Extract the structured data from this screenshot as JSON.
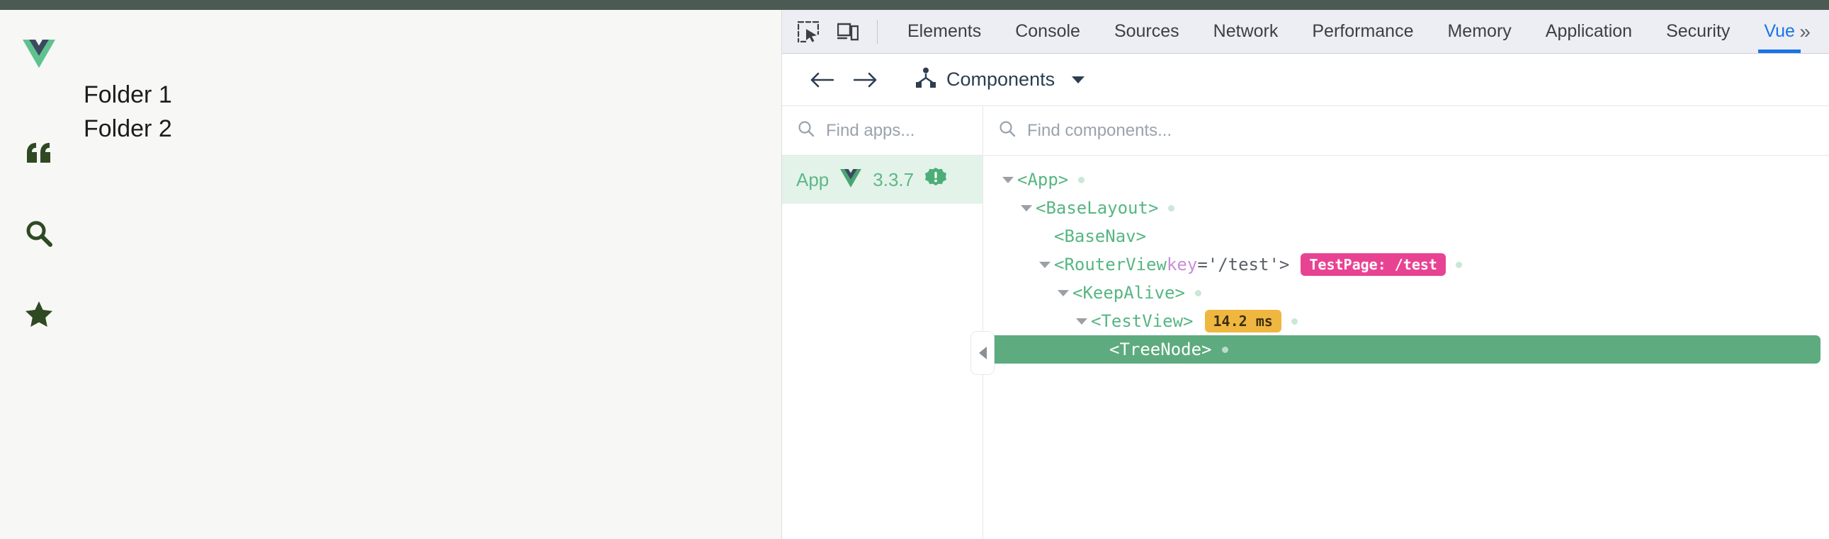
{
  "page": {
    "sidebar_icons": [
      {
        "name": "quote-icon",
        "glyph": "quote"
      },
      {
        "name": "search-icon",
        "glyph": "search"
      },
      {
        "name": "star-icon",
        "glyph": "star"
      }
    ],
    "logo_label": "Vue logo",
    "folders": [
      "Folder 1",
      "Folder 2"
    ],
    "icon_color": "#2f4a22",
    "background": "#f7f7f5"
  },
  "devtools": {
    "toolbar_icons": {
      "inspect": "inspect-element-icon",
      "device": "device-toolbar-icon"
    },
    "tabs": [
      {
        "label": "Elements",
        "active": false
      },
      {
        "label": "Console",
        "active": false
      },
      {
        "label": "Sources",
        "active": false
      },
      {
        "label": "Network",
        "active": false
      },
      {
        "label": "Performance",
        "active": false
      },
      {
        "label": "Memory",
        "active": false
      },
      {
        "label": "Application",
        "active": false
      },
      {
        "label": "Security",
        "active": false
      },
      {
        "label": "Vue",
        "active": true
      }
    ],
    "more_tabs_label": "»",
    "active_tab_color": "#1a73e8",
    "tabbar_background": "#eceef3"
  },
  "vue_panel": {
    "nav": {
      "back_label": "←",
      "forward_label": "→",
      "view_title": "Components",
      "view_icon": "components-tree-icon"
    },
    "apps": {
      "search_placeholder": "Find apps...",
      "items": [
        {
          "name": "App",
          "version": "3.3.7",
          "badge": "warning-badge",
          "selected": true
        }
      ],
      "selected_background": "#e3f3e9",
      "text_color": "#5fb786"
    },
    "components": {
      "search_placeholder": "Find components...",
      "collapse_handle": "collapse-apps-panel",
      "tree": [
        {
          "depth": 0,
          "twisty": true,
          "tag": "<App>",
          "dot": true,
          "selected": false
        },
        {
          "depth": 1,
          "twisty": true,
          "tag": "<BaseLayout>",
          "dot": true,
          "selected": false
        },
        {
          "depth": 2,
          "twisty": false,
          "tag": "<BaseNav>",
          "dot": false,
          "selected": false
        },
        {
          "depth": 2,
          "twisty": true,
          "tag": "<RouterView",
          "attr_name": "key",
          "attr_value": "='/test'>",
          "badge": "TestPage: /test",
          "badge_type": "pink",
          "dot": true,
          "selected": false
        },
        {
          "depth": 3,
          "twisty": true,
          "tag": "<KeepAlive>",
          "dot": true,
          "selected": false
        },
        {
          "depth": 4,
          "twisty": true,
          "tag": "<TestView>",
          "badge": "14.2 ms",
          "badge_type": "orange",
          "dot": true,
          "selected": false
        },
        {
          "depth": 5,
          "twisty": false,
          "tag": "<TreeNode>",
          "dot": true,
          "selected": true
        }
      ],
      "selected_background": "#5dab7e",
      "tag_color": "#56b682"
    }
  }
}
